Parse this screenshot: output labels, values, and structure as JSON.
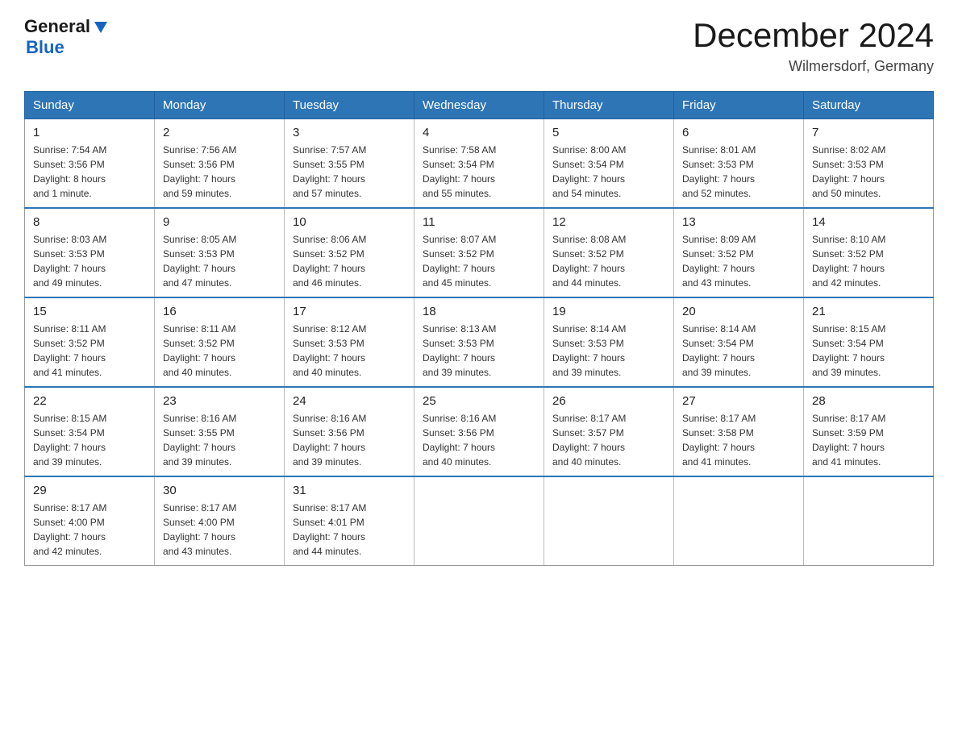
{
  "header": {
    "logo_general": "General",
    "logo_blue": "Blue",
    "month_year": "December 2024",
    "location": "Wilmersdorf, Germany"
  },
  "weekdays": [
    "Sunday",
    "Monday",
    "Tuesday",
    "Wednesday",
    "Thursday",
    "Friday",
    "Saturday"
  ],
  "weeks": [
    [
      {
        "day": "1",
        "info": "Sunrise: 7:54 AM\nSunset: 3:56 PM\nDaylight: 8 hours\nand 1 minute."
      },
      {
        "day": "2",
        "info": "Sunrise: 7:56 AM\nSunset: 3:56 PM\nDaylight: 7 hours\nand 59 minutes."
      },
      {
        "day": "3",
        "info": "Sunrise: 7:57 AM\nSunset: 3:55 PM\nDaylight: 7 hours\nand 57 minutes."
      },
      {
        "day": "4",
        "info": "Sunrise: 7:58 AM\nSunset: 3:54 PM\nDaylight: 7 hours\nand 55 minutes."
      },
      {
        "day": "5",
        "info": "Sunrise: 8:00 AM\nSunset: 3:54 PM\nDaylight: 7 hours\nand 54 minutes."
      },
      {
        "day": "6",
        "info": "Sunrise: 8:01 AM\nSunset: 3:53 PM\nDaylight: 7 hours\nand 52 minutes."
      },
      {
        "day": "7",
        "info": "Sunrise: 8:02 AM\nSunset: 3:53 PM\nDaylight: 7 hours\nand 50 minutes."
      }
    ],
    [
      {
        "day": "8",
        "info": "Sunrise: 8:03 AM\nSunset: 3:53 PM\nDaylight: 7 hours\nand 49 minutes."
      },
      {
        "day": "9",
        "info": "Sunrise: 8:05 AM\nSunset: 3:53 PM\nDaylight: 7 hours\nand 47 minutes."
      },
      {
        "day": "10",
        "info": "Sunrise: 8:06 AM\nSunset: 3:52 PM\nDaylight: 7 hours\nand 46 minutes."
      },
      {
        "day": "11",
        "info": "Sunrise: 8:07 AM\nSunset: 3:52 PM\nDaylight: 7 hours\nand 45 minutes."
      },
      {
        "day": "12",
        "info": "Sunrise: 8:08 AM\nSunset: 3:52 PM\nDaylight: 7 hours\nand 44 minutes."
      },
      {
        "day": "13",
        "info": "Sunrise: 8:09 AM\nSunset: 3:52 PM\nDaylight: 7 hours\nand 43 minutes."
      },
      {
        "day": "14",
        "info": "Sunrise: 8:10 AM\nSunset: 3:52 PM\nDaylight: 7 hours\nand 42 minutes."
      }
    ],
    [
      {
        "day": "15",
        "info": "Sunrise: 8:11 AM\nSunset: 3:52 PM\nDaylight: 7 hours\nand 41 minutes."
      },
      {
        "day": "16",
        "info": "Sunrise: 8:11 AM\nSunset: 3:52 PM\nDaylight: 7 hours\nand 40 minutes."
      },
      {
        "day": "17",
        "info": "Sunrise: 8:12 AM\nSunset: 3:53 PM\nDaylight: 7 hours\nand 40 minutes."
      },
      {
        "day": "18",
        "info": "Sunrise: 8:13 AM\nSunset: 3:53 PM\nDaylight: 7 hours\nand 39 minutes."
      },
      {
        "day": "19",
        "info": "Sunrise: 8:14 AM\nSunset: 3:53 PM\nDaylight: 7 hours\nand 39 minutes."
      },
      {
        "day": "20",
        "info": "Sunrise: 8:14 AM\nSunset: 3:54 PM\nDaylight: 7 hours\nand 39 minutes."
      },
      {
        "day": "21",
        "info": "Sunrise: 8:15 AM\nSunset: 3:54 PM\nDaylight: 7 hours\nand 39 minutes."
      }
    ],
    [
      {
        "day": "22",
        "info": "Sunrise: 8:15 AM\nSunset: 3:54 PM\nDaylight: 7 hours\nand 39 minutes."
      },
      {
        "day": "23",
        "info": "Sunrise: 8:16 AM\nSunset: 3:55 PM\nDaylight: 7 hours\nand 39 minutes."
      },
      {
        "day": "24",
        "info": "Sunrise: 8:16 AM\nSunset: 3:56 PM\nDaylight: 7 hours\nand 39 minutes."
      },
      {
        "day": "25",
        "info": "Sunrise: 8:16 AM\nSunset: 3:56 PM\nDaylight: 7 hours\nand 40 minutes."
      },
      {
        "day": "26",
        "info": "Sunrise: 8:17 AM\nSunset: 3:57 PM\nDaylight: 7 hours\nand 40 minutes."
      },
      {
        "day": "27",
        "info": "Sunrise: 8:17 AM\nSunset: 3:58 PM\nDaylight: 7 hours\nand 41 minutes."
      },
      {
        "day": "28",
        "info": "Sunrise: 8:17 AM\nSunset: 3:59 PM\nDaylight: 7 hours\nand 41 minutes."
      }
    ],
    [
      {
        "day": "29",
        "info": "Sunrise: 8:17 AM\nSunset: 4:00 PM\nDaylight: 7 hours\nand 42 minutes."
      },
      {
        "day": "30",
        "info": "Sunrise: 8:17 AM\nSunset: 4:00 PM\nDaylight: 7 hours\nand 43 minutes."
      },
      {
        "day": "31",
        "info": "Sunrise: 8:17 AM\nSunset: 4:01 PM\nDaylight: 7 hours\nand 44 minutes."
      },
      {
        "day": "",
        "info": ""
      },
      {
        "day": "",
        "info": ""
      },
      {
        "day": "",
        "info": ""
      },
      {
        "day": "",
        "info": ""
      }
    ]
  ]
}
